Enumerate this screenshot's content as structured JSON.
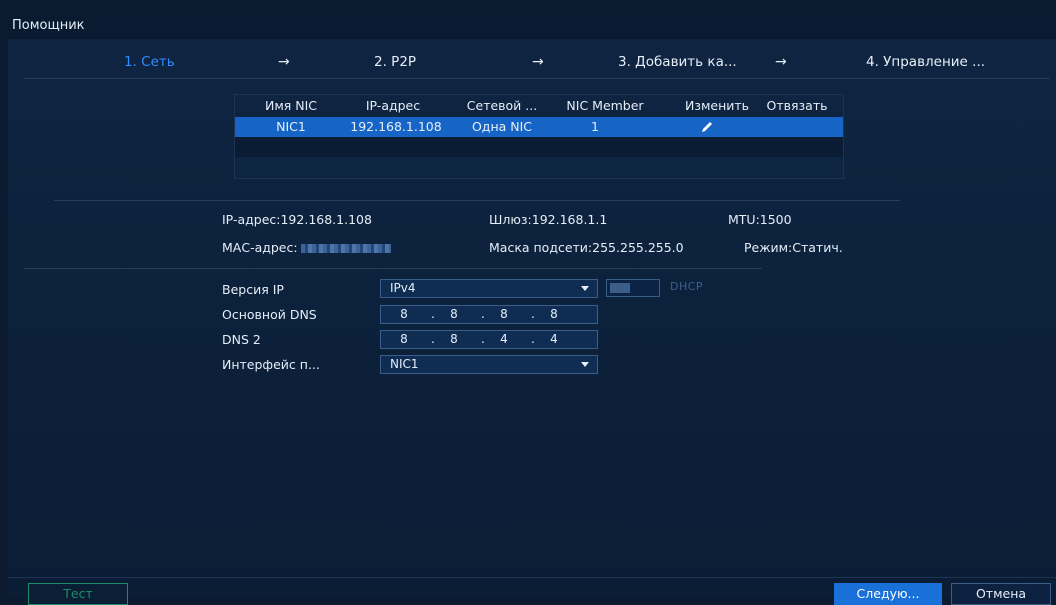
{
  "window": {
    "title": "Помощник"
  },
  "steps": [
    {
      "label": "1. Сеть",
      "active": true
    },
    {
      "label": "2. P2P",
      "active": false
    },
    {
      "label": "3. Добавить ка...",
      "active": false
    },
    {
      "label": "4. Управление ...",
      "active": false
    }
  ],
  "arrow_glyph": "→",
  "nic_table": {
    "headers": [
      "Имя NIC",
      "IP-адрес",
      "Сетевой ...",
      "NIC Member",
      "Изменить",
      "Отвязать"
    ],
    "rows": [
      {
        "name": "NIC1",
        "ip": "192.168.1.108",
        "mode": "Одна NIC",
        "member": "1",
        "edit_icon": "pencil-icon"
      }
    ]
  },
  "info": {
    "ip_label": "IP-адрес:",
    "ip_value": "192.168.1.108",
    "gateway_label": "Шлюз:",
    "gateway_value": "192.168.1.1",
    "mtu_label": "MTU:",
    "mtu_value": "1500",
    "mac_label": "МАС-адрес:",
    "mask_label": "Маска подсети:",
    "mask_value": "255.255.255.0",
    "mode_label": "Режим:",
    "mode_value": "Статич."
  },
  "form": {
    "ip_version_label": "Версия IP",
    "ip_version_value": "IPv4",
    "dhcp_label": "DHCP",
    "dhcp_enabled": false,
    "primary_dns_label": "Основной DNS",
    "primary_dns": [
      "8",
      "8",
      "8",
      "8"
    ],
    "dns2_label": "DNS 2",
    "dns2": [
      "8",
      "8",
      "4",
      "4"
    ],
    "interface_label": "Интерфейс п...",
    "interface_value": "NIC1"
  },
  "buttons": {
    "test": "Тест",
    "next": "Следую...",
    "cancel": "Отмена"
  },
  "colors": {
    "accent": "#2e8cff",
    "selected_row": "#1665c6",
    "test_button": "#1f8b6b"
  }
}
